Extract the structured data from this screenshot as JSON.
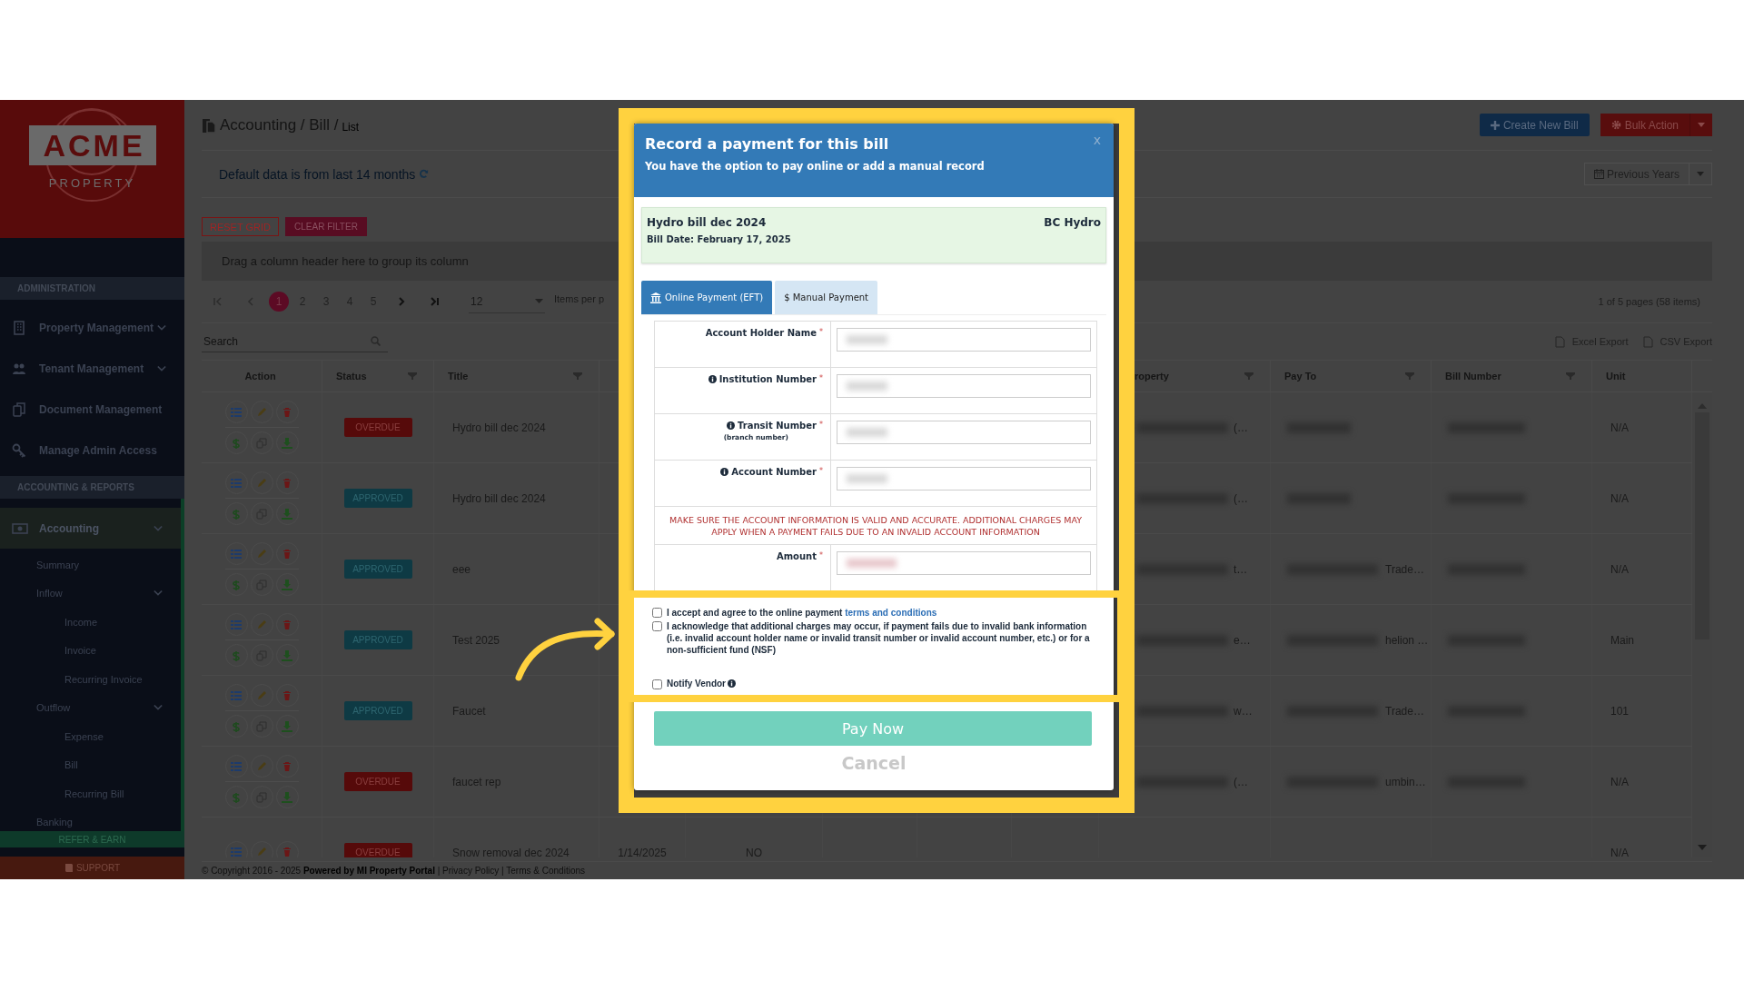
{
  "sidebar": {
    "logo": {
      "wordmark": "ACME",
      "tagline": "PROPERTY"
    },
    "sections": [
      {
        "heading": "ADMINISTRATION",
        "items": [
          {
            "label": "Property Management",
            "expandable": true,
            "selected": false
          },
          {
            "label": "Tenant Management",
            "expandable": true,
            "selected": false
          },
          {
            "label": "Document Management",
            "expandable": false,
            "selected": false
          },
          {
            "label": "Manage Admin Access",
            "expandable": false,
            "selected": false
          }
        ]
      },
      {
        "heading": "ACCOUNTING & REPORTS",
        "items": [
          {
            "label": "Accounting",
            "expandable": true,
            "selected": true,
            "children": [
              {
                "label": "Summary",
                "expandable": false,
                "selected": false
              },
              {
                "label": "Inflow",
                "expandable": true,
                "selected": false,
                "children": [
                  {
                    "label": "Income",
                    "expandable": false,
                    "selected": false
                  },
                  {
                    "label": "Invoice",
                    "expandable": false,
                    "selected": false
                  },
                  {
                    "label": "Recurring Invoice",
                    "expandable": false,
                    "selected": false
                  }
                ]
              },
              {
                "label": "Outflow",
                "expandable": true,
                "selected": false,
                "children": [
                  {
                    "label": "Expense",
                    "expandable": false,
                    "selected": false
                  },
                  {
                    "label": "Bill",
                    "expandable": false,
                    "selected": false
                  },
                  {
                    "label": "Recurring Bill",
                    "expandable": false,
                    "selected": false
                  }
                ]
              },
              {
                "label": "Banking",
                "expandable": false,
                "selected": false
              }
            ]
          }
        ]
      }
    ],
    "footer_buttons": [
      {
        "label": "REFER & EARN",
        "kind": "refer"
      },
      {
        "label": "SUPPORT",
        "kind": "support"
      }
    ]
  },
  "main": {
    "breadcrumb": {
      "path": "Accounting / Bill /",
      "current": "List"
    },
    "header_buttons": [
      {
        "label": "Create New Bill",
        "kind": "primary"
      },
      {
        "label": "Bulk Action",
        "kind": "danger-split"
      }
    ],
    "notice": "Default data is from last 14 months",
    "period_dropdown": "Previous Years",
    "grid_buttons": [
      {
        "label": "RESET GRID",
        "kind": "outline"
      },
      {
        "label": "CLEAR FILTER",
        "kind": "filled"
      }
    ],
    "group_panel": "Drag a column header here to group its column",
    "pager": {
      "pages": [
        {
          "label": "1",
          "selected": true
        },
        {
          "label": "2",
          "selected": false
        },
        {
          "label": "3",
          "selected": false
        },
        {
          "label": "4",
          "selected": false
        },
        {
          "label": "5",
          "selected": false
        }
      ],
      "page_size": "12",
      "page_size_label": "Items per p",
      "summary": "1 of 5 pages (58 items)"
    },
    "search": {
      "placeholder": "Search"
    },
    "exports": [
      "Excel Export",
      "CSV Export"
    ],
    "table": {
      "columns": [
        {
          "label": "Action",
          "filter": false
        },
        {
          "label": "Status",
          "filter": true
        },
        {
          "label": "Title",
          "filter": true
        },
        {
          "label": "roperty",
          "filter": true
        },
        {
          "label": "Pay To",
          "filter": true
        },
        {
          "label": "Bill Number",
          "filter": true
        },
        {
          "label": "Unit",
          "filter": false
        }
      ],
      "rows": [
        {
          "status": "OVERDUE",
          "kind": "overdue",
          "title": "Hydro bill dec 2024",
          "property": "(…",
          "unit": "N/A"
        },
        {
          "status": "APPROVED",
          "kind": "approved",
          "title": "Hydro bill dec 2024",
          "property": "(…",
          "unit": "N/A"
        },
        {
          "status": "APPROVED",
          "kind": "approved",
          "title": "eee",
          "property": "t…",
          "pay_to": "Trade…",
          "unit": "N/A"
        },
        {
          "status": "APPROVED",
          "kind": "approved",
          "title": "Test 2025",
          "property": "e…",
          "pay_to": "helion …",
          "unit": "Main"
        },
        {
          "status": "APPROVED",
          "kind": "approved",
          "title": "Faucet",
          "property": "w…",
          "pay_to": "Trade…",
          "unit": "101"
        },
        {
          "status": "OVERDUE",
          "kind": "overdue",
          "title": "faucet rep",
          "property": "(…",
          "pay_to": "umbin…",
          "unit": "N/A"
        },
        {
          "status": "OVERDUE",
          "kind": "overdue",
          "title": "Snow removal dec 2024",
          "column_4": "1/14/2025",
          "column_5": "NO",
          "unit": "N/A"
        }
      ]
    },
    "footer": "© Copyright 2016 - 2025 **Powered by MI Property Portal** | Privacy Policy | Terms & Conditions"
  },
  "modal": {
    "title": "Record a payment for this bill",
    "subtitle": "You have the option to pay online or add a manual record",
    "close": "x",
    "bill": {
      "title": "Hydro bill dec 2024",
      "vendor": "BC Hydro",
      "date": "Bill Date: February 17, 2025"
    },
    "tabs": [
      {
        "label": "Online Payment (EFT)",
        "selected": true
      },
      {
        "label": "$ Manual Payment",
        "selected": false
      }
    ],
    "fields": [
      {
        "label": "Account Holder Name",
        "mark": "*",
        "info": false
      },
      {
        "label": "Institution Number",
        "mark": "*",
        "info": true
      },
      {
        "label": "Transit Number",
        "mark": "*",
        "info": true,
        "note": "(branch number)"
      },
      {
        "label": "Account Number",
        "mark": "*",
        "info": true
      }
    ],
    "warning": "MAKE SURE THE ACCOUNT INFORMATION IS VALID AND ACCURATE. ADDITIONAL CHARGES MAY APPLY WHEN A PAYMENT FAILS DUE TO AN INVALID ACCOUNT INFORMATION",
    "amount": {
      "label": "Amount",
      "mark": "*"
    },
    "agreements": [
      {
        "text": "I accept and agree to the online payment ",
        "link": "terms and conditions",
        "checked": false,
        "info": false
      },
      {
        "text": "I acknowledge that additional charges may occur, if payment fails due to invalid bank information (i.e. invalid account holder name or invalid transit number or invalid account number, etc.) or for a non-sufficient fund (NSF)",
        "checked": false,
        "info": false
      },
      {
        "text": "Notify Vendor",
        "checked": false,
        "info": true
      }
    ],
    "pay_button": "Pay Now",
    "cancel": "Cancel"
  }
}
